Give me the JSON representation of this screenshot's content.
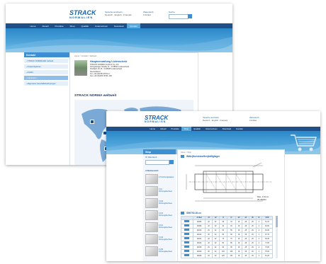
{
  "back": {
    "logo": {
      "line1": "STRACK",
      "line2": "NORMALIEN"
    },
    "top_links": {
      "contact_label": "Sprache wechseln",
      "contact_sub": "Deutsch · English · Français",
      "cart_label": "Warenkorb",
      "cart_sub": "0 Artikel",
      "search_label": "Suche"
    },
    "nav": [
      "Home",
      "Aktuell",
      "Produkte",
      "Shop",
      "Qualität",
      "Unternehmen",
      "Download",
      "Kontakt"
    ],
    "nav_active_index": 7,
    "panel_title": "Kontakt",
    "side_items": [
      "STRACK NORMALIEN weltweit",
      "Ansprechpartner",
      "Anfahrt",
      "Impressum",
      "Allgemeine Geschäftsbedingungen"
    ],
    "side_selected_index": 3,
    "breadcrumb": "Home  >  Kontakt  >  Weltweit",
    "company": {
      "title": "Hauptverwaltung Lüdenscheid",
      "lines": [
        "STRACK NORMA GmbH & Co. KG",
        "Königsberger Straße 11 · D-58511 Lüdenscheid",
        "Postfach 15 15 · D-58465 Lüdenscheid",
        "Deutschland",
        "Tel. +49 (0)2351 8701-0",
        "Fax +49 (0)2351 8701-100"
      ]
    },
    "worldwide_heading": "STRACK NORMA weltweit"
  },
  "front": {
    "logo": {
      "line1": "STRACK",
      "line2": "NORMALIEN"
    },
    "top_links": {
      "contact_label": "Sprache wechseln",
      "contact_sub": "Deutsch · English · Français",
      "cart_label": "Warenkorb",
      "cart_sub": "0 Artikel"
    },
    "nav": [
      "Home",
      "Aktuell",
      "Produkte",
      "Shop",
      "Qualität",
      "Unternehmen",
      "Download",
      "Kontakt"
    ],
    "nav_active_index": 3,
    "panel_title": "Shop",
    "search_label": "Ihr Warenkorb",
    "side_heading": "Artikelauswahl",
    "products": [
      "Z 5   Führungssäulen",
      "Z 10   Führungsbuchsen",
      "Z 100   Führungsbuchsen",
      "Z 101   Führungsbuchsen",
      "Z 110   Führungsbuchsen",
      "Z 120   Führungsbuchsen",
      "Z 200   Führungsbuchsen"
    ],
    "breadcrumb": "Home  >  Shop",
    "drawing_title": "Wälz(Kunststoffen)käfiglager",
    "drawing_note": "Max. 1,5mm/",
    "drawing_note2": "35-45HRC",
    "table_title": "SN0702-20-xx",
    "table_headers": [
      "Artikel",
      "d1",
      "d2",
      "l1",
      "l2",
      "d3",
      "d4",
      "d5",
      "l3",
      "EUR"
    ],
    "table_rows": [
      [
        "20006",
        "20",
        "32",
        "28",
        "34",
        "18",
        "28",
        "26",
        "4",
        "61,10"
      ],
      [
        "20008",
        "20",
        "32",
        "40",
        "46",
        "18",
        "28",
        "26",
        "4",
        "62,50"
      ],
      [
        "20010",
        "20",
        "32",
        "50",
        "56",
        "18",
        "28",
        "26",
        "4",
        "64,90"
      ],
      [
        "20012",
        "20",
        "32",
        "60",
        "66",
        "18",
        "28",
        "26",
        "4",
        "67,15"
      ],
      [
        "20014",
        "20",
        "32",
        "70",
        "76",
        "18",
        "28",
        "26",
        "4",
        "69,30"
      ],
      [
        "20016",
        "20",
        "32",
        "80",
        "86",
        "18",
        "28",
        "26",
        "4",
        "71,55"
      ],
      [
        "20018",
        "20",
        "32",
        "90",
        "96",
        "18",
        "28",
        "26",
        "4",
        "73,80"
      ],
      [
        "20020",
        "20",
        "32",
        "100",
        "106",
        "18",
        "28",
        "26",
        "4",
        "76,00"
      ],
      [
        "20025",
        "20",
        "32",
        "125",
        "131",
        "18",
        "28",
        "26",
        "4",
        "81,25"
      ]
    ]
  },
  "colors": {
    "brand": "#1763ad",
    "nav": "#1e4f88",
    "accent": "#54a8de",
    "panel": "#3d8fd1"
  }
}
